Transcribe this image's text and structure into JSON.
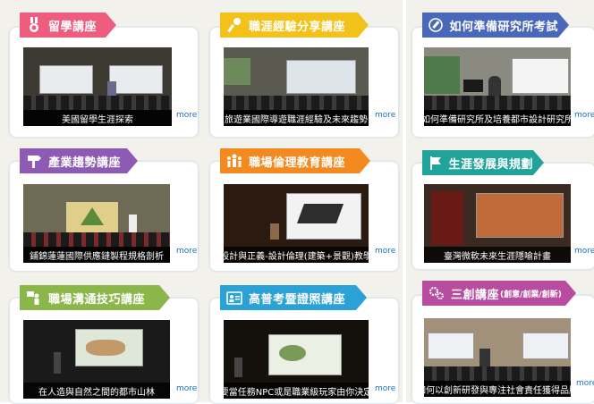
{
  "more_label": "more",
  "cards": [
    {
      "title": "留學講座",
      "icon": "medal-icon",
      "color": "#ef5d7e",
      "caption": "美國留學生涯探索"
    },
    {
      "title": "職涯經驗分享講座",
      "icon": "microphone-icon",
      "color": "#f2c21a",
      "caption": "旅遊業國際導遊職涯經驗及未來趨勢"
    },
    {
      "title": "如何準備研究所考試",
      "icon": "pencil-icon",
      "color": "#4a68b9",
      "caption": "如何準備研究所及培養都市設計研究所"
    },
    {
      "title": "產業趨勢講座",
      "icon": "signpost-icon",
      "color": "#8d5bb4",
      "caption": "鋪錦蓮蓮國際供應鏈製程規格剖析"
    },
    {
      "title": "職場倫理教育講座",
      "icon": "people-icon",
      "color": "#f48a1f",
      "caption": "設計與正義-設計倫理(建築+景觀)教學"
    },
    {
      "title": "生涯發展與規劃",
      "icon": "flag-icon",
      "color": "#22a39a",
      "caption": "臺灣微軟未來生涯隱喻計畫"
    },
    {
      "title": "職場溝通技巧講座",
      "icon": "chat-person-icon",
      "color": "#8bb74a",
      "caption": "在人造與自然之間的都市山林"
    },
    {
      "title": "高普考暨證照講座",
      "icon": "id-card-icon",
      "color": "#2ba2d6",
      "caption": "要當任務NPC或是職業級玩家由你決定"
    },
    {
      "title": "三創講座",
      "title_suffix": "(創意/創業/創新)",
      "icon": "gears-icon",
      "color": "#b84c9e",
      "caption": "如何以創新研發與專注社會責任獲得品牌"
    }
  ]
}
